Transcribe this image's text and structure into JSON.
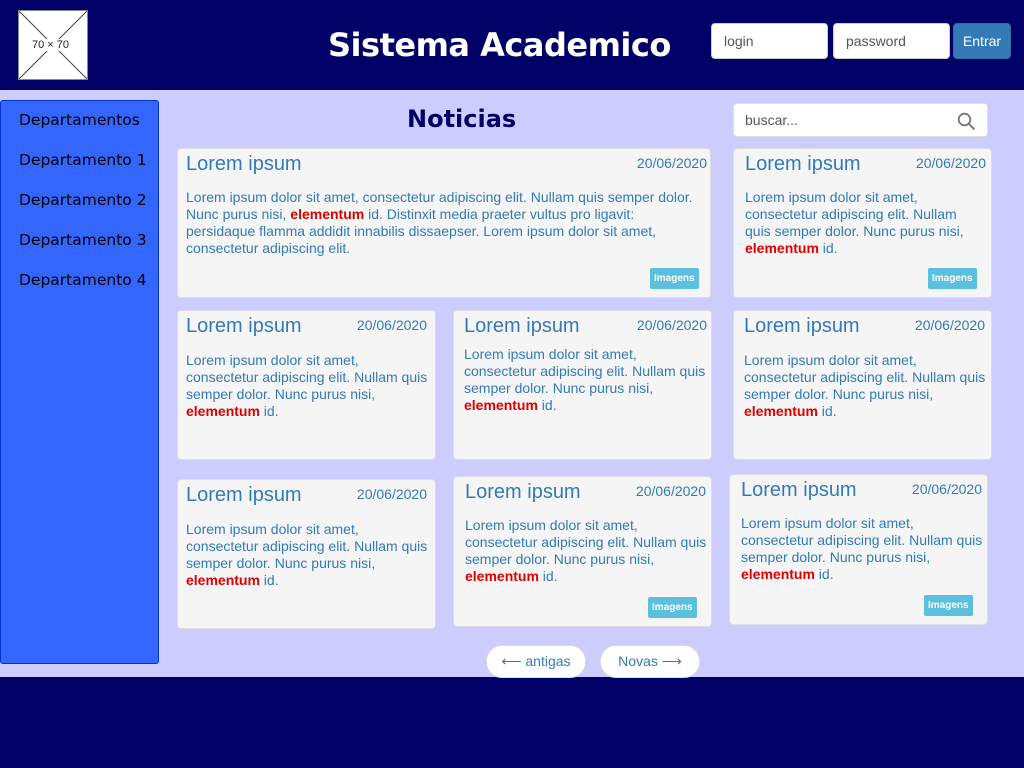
{
  "header": {
    "logo_text": "70 × 70",
    "title": "Sistema Academico",
    "login_placeholder": "login",
    "password_placeholder": "password",
    "enter_label": "Entrar"
  },
  "sidebar": {
    "items": [
      "Departamentos",
      "Departamento 1",
      "Departamento 2",
      "Departamento 3",
      "Departamento 4"
    ]
  },
  "main": {
    "title": "Noticias",
    "search_placeholder": "buscar...",
    "cards": [
      {
        "title": "Lorem ipsum",
        "date": "20/06/2020",
        "text_before": "Lorem ipsum dolor sit amet, consectetur adipiscing elit. Nullam quis semper dolor. Nunc purus nisi, ",
        "highlight": "elementum",
        "text_after": " id. Distinxit  media praeter vultus pro ligavit: persidaque flamma addidit innabilis dissaepser. Lorem ipsum dolor sit amet, consectetur adipiscing elit.",
        "badge": "Imagens"
      },
      {
        "title": "Lorem ipsum",
        "date": "20/06/2020",
        "text_before": "Lorem ipsum dolor sit amet, consectetur adipiscing elit. Nullam quis semper dolor. Nunc purus nisi, ",
        "highlight": "elementum",
        "text_after": " id.",
        "badge": "Imagens"
      },
      {
        "title": "Lorem ipsum",
        "date": "20/06/2020",
        "text_before": "Lorem ipsum dolor sit amet, consectetur adipiscing elit. Nullam quis semper dolor. Nunc purus nisi, ",
        "highlight": "elementum",
        "text_after": " id."
      },
      {
        "title": "Lorem ipsum",
        "date": "20/06/2020",
        "text_before": "Lorem ipsum dolor sit amet, consectetur adipiscing elit. Nullam quis semper dolor. Nunc purus nisi, ",
        "highlight": "elementum",
        "text_after": " id."
      },
      {
        "title": "Lorem ipsum",
        "date": "20/06/2020",
        "text_before": "Lorem ipsum dolor sit amet, consectetur adipiscing elit. Nullam quis semper dolor. Nunc purus nisi, ",
        "highlight": "elementum",
        "text_after": " id."
      },
      {
        "title": "Lorem ipsum",
        "date": "20/06/2020",
        "text_before": "Lorem ipsum dolor sit amet, consectetur adipiscing elit. Nullam quis semper dolor. Nunc purus nisi, ",
        "highlight": "elementum",
        "text_after": " id."
      },
      {
        "title": "Lorem ipsum",
        "date": "20/06/2020",
        "text_before": "Lorem ipsum dolor sit amet, consectetur adipiscing elit. Nullam quis semper dolor. Nunc purus nisi, ",
        "highlight": "elementum",
        "text_after": " id.",
        "badge": "Imagens"
      },
      {
        "title": "Lorem ipsum",
        "date": "20/06/2020",
        "text_before": "Lorem ipsum dolor sit amet, consectetur adipiscing elit. Nullam quis semper dolor. Nunc purus nisi, ",
        "highlight": "elementum",
        "text_after": " id.",
        "badge": "Imagens"
      }
    ],
    "pager": {
      "older": "⟵ antigas",
      "newer": "Novas ⟶"
    }
  },
  "colors": {
    "header_bg": "#000066",
    "content_bg": "#ccccff",
    "sidebar_bg": "#3366ff",
    "link": "#337ab7",
    "highlight": "#dd0000",
    "badge": "#5bc0de"
  }
}
